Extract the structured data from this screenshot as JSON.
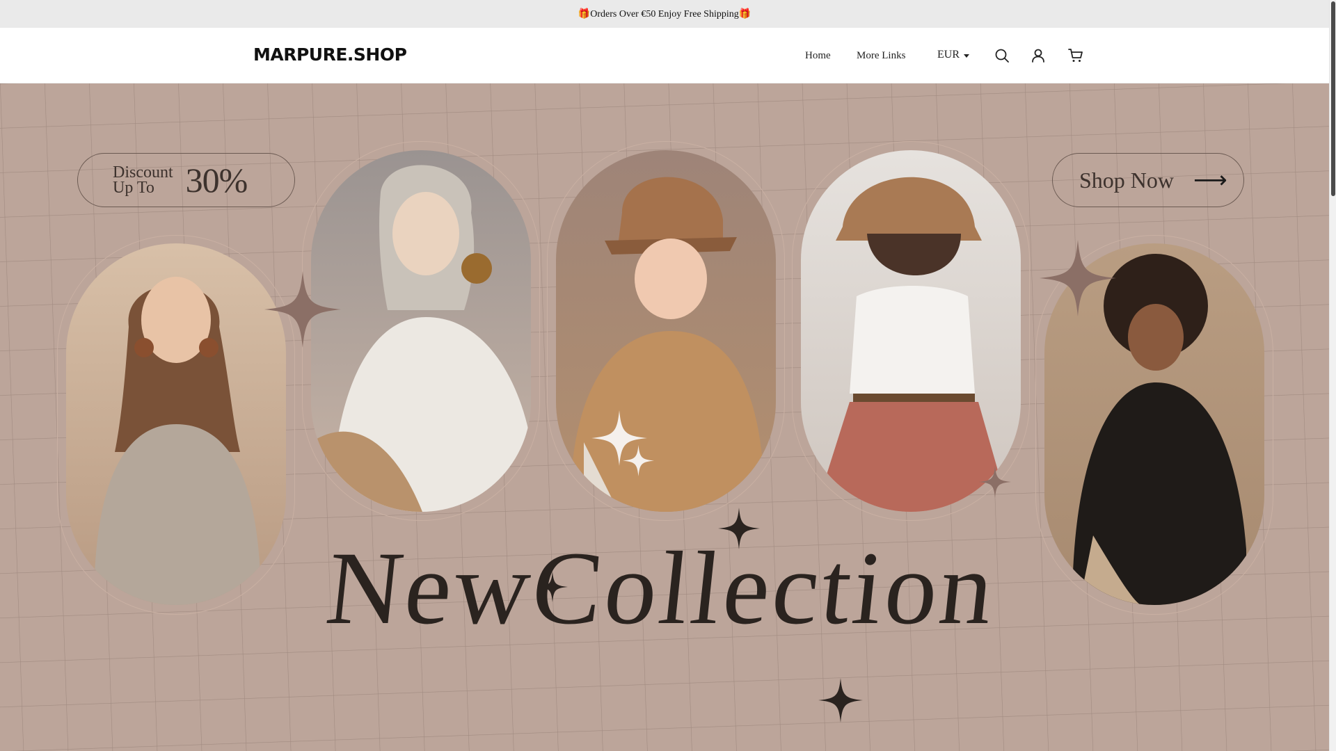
{
  "announcement": {
    "text": "🎁Orders Over €50 Enjoy Free Shipping🎁"
  },
  "header": {
    "logo": "MARPURE.SHOP",
    "nav": [
      {
        "label": "Home"
      },
      {
        "label": "More Links"
      }
    ],
    "currency": "EUR",
    "icons": [
      "search-icon",
      "account-icon",
      "cart-icon"
    ]
  },
  "hero": {
    "discount_label": "Discount Up To",
    "discount_line1": "Discount",
    "discount_line2": "Up To",
    "discount_value": "30%",
    "shop_now": "Shop Now",
    "headline": "NewCollection",
    "colors": {
      "background": "#bca59a",
      "text": "#2a231f",
      "line": "#6b5a52"
    }
  }
}
